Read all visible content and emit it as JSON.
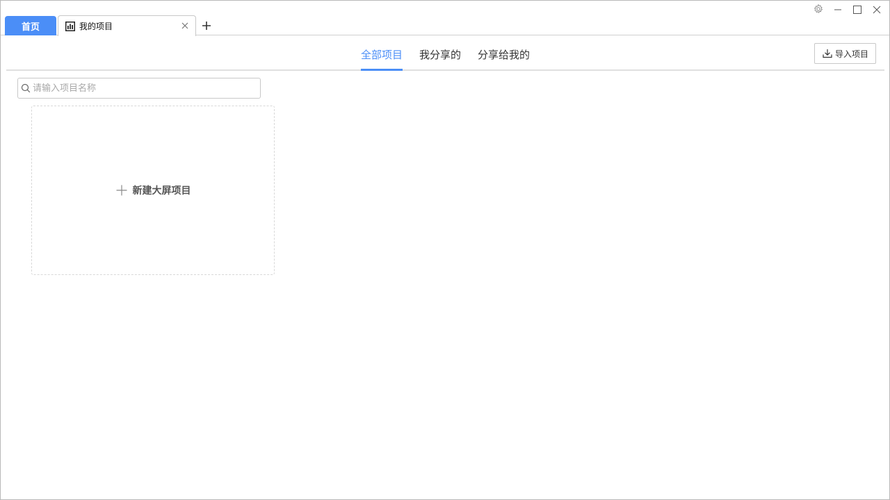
{
  "tabs": {
    "home_label": "首页",
    "active_label": "我的项目",
    "active_icon": "bar-chart-icon"
  },
  "window_controls": [
    "gear-icon",
    "minimize-icon",
    "maximize-icon",
    "close-icon"
  ],
  "subnav": {
    "tabs": [
      {
        "label": "全部项目",
        "active": true
      },
      {
        "label": "我分享的",
        "active": false
      },
      {
        "label": "分享给我的",
        "active": false
      }
    ],
    "import_label": "导入项目"
  },
  "search": {
    "placeholder": "请输入项目名称",
    "value": ""
  },
  "new_project": {
    "label": "新建大屏项目"
  },
  "colors": {
    "accent": "#4b8ef7",
    "border": "#c8c8c8",
    "dashed_border": "#d8d8d8"
  }
}
